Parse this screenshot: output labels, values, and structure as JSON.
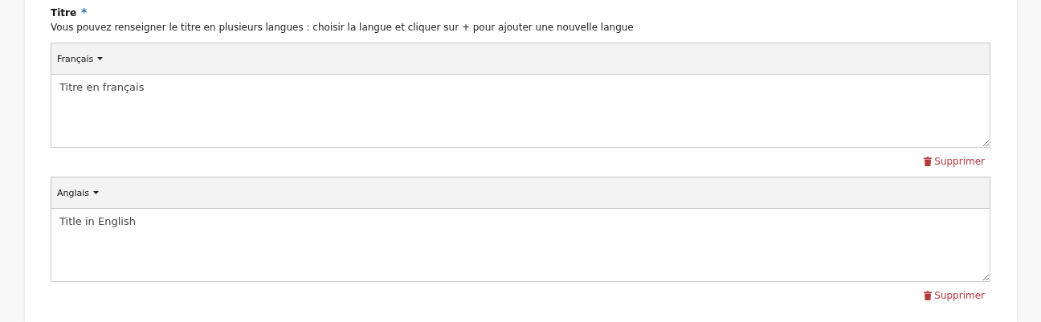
{
  "field": {
    "label": "Titre",
    "required_mark": "*",
    "help": "Vous pouvez renseigner le titre en plusieurs langues : choisir la langue et cliquer sur + pour ajouter une nouvelle langue"
  },
  "languages": [
    {
      "language": "Français",
      "value": "Titre en français",
      "delete": "Supprimer"
    },
    {
      "language": "Anglais",
      "value": "Title in English",
      "delete": "Supprimer"
    }
  ]
}
